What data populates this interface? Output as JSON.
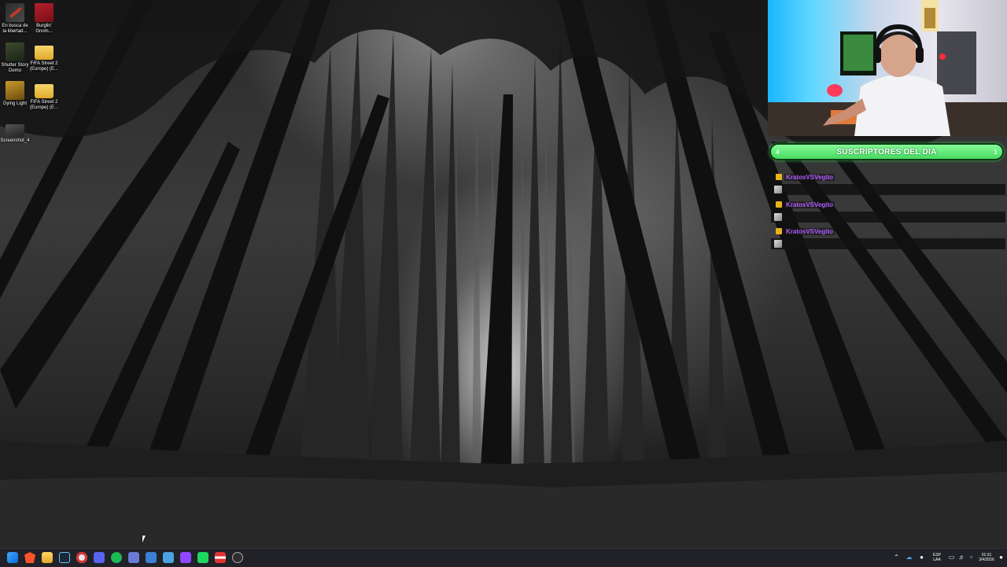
{
  "desktop": {
    "icons": [
      {
        "label": "En busca de la libertad...",
        "icon": "brush-game-icon"
      },
      {
        "label": "Burglin' Gnom...",
        "icon": "burglin-gnomes-icon"
      },
      {
        "label": "Shutter Story Demo",
        "icon": "shutter-story-icon"
      },
      {
        "label": "FIFA Street 2 (Europe) (E...",
        "icon": "folder-icon"
      },
      {
        "label": "Dying Light",
        "icon": "dying-light-icon"
      },
      {
        "label": "FIFA Street 2 (Europe) (E...",
        "icon": "folder-icon"
      },
      {
        "label": "Screenshot_4",
        "icon": "image-file-icon"
      }
    ]
  },
  "overlay": {
    "subs_widget": {
      "title": "SUSCRIPTORES DEL DIA",
      "left_count": "4",
      "right_count": "1",
      "accent": "#3fd65a"
    },
    "chat": [
      {
        "username": "KratosVSVegito"
      },
      {
        "username": "KratosVSVegito"
      },
      {
        "username": "KratosVSVegito"
      }
    ],
    "username_color": "#b05cff"
  },
  "taskbar": {
    "apps": [
      "windows-start-icon",
      "brave-browser-icon",
      "file-explorer-icon",
      "steam-icon",
      "discord-icon",
      "chrome-icon",
      "spotify-icon",
      "window-app-icon",
      "network-app-icon",
      "game-launcher-icon",
      "twitch-icon",
      "green-app-icon",
      "media-app-icon",
      "obs-app-icon"
    ],
    "tray": {
      "language_top": "ESP",
      "language_bottom": "LAA",
      "time": "01:31",
      "date": "3/4/2026"
    }
  }
}
